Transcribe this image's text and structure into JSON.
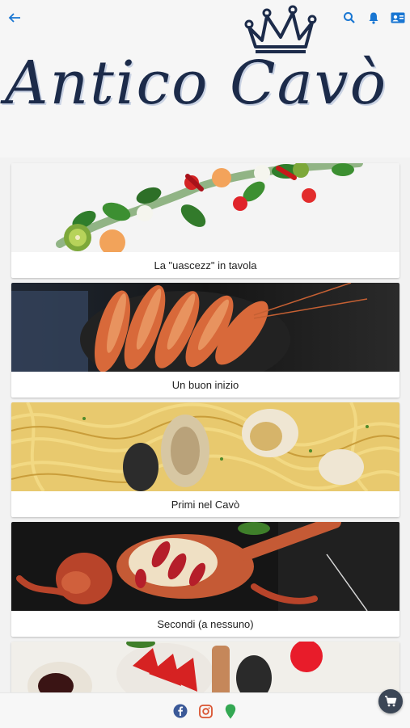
{
  "header": {
    "logo_text": "Antico Cavò",
    "back_icon": "arrow-left-icon",
    "search_icon": "search-icon",
    "notifications_icon": "bell-icon",
    "contacts_icon": "contact-card-icon",
    "accent_color": "#1976d2"
  },
  "menu": {
    "categories": [
      {
        "label": "La \"uascezz\" in tavola",
        "image": "salad-vegetables"
      },
      {
        "label": "Un buon inizio",
        "image": "grilled-prawns"
      },
      {
        "label": "Primi nel Cavò",
        "image": "spaghetti-clams"
      },
      {
        "label": "Secondi (a nessuno)",
        "image": "lobster"
      },
      {
        "label": "",
        "image": "strawberry-dessert"
      }
    ]
  },
  "footer": {
    "facebook_icon": "facebook-icon",
    "instagram_icon": "instagram-icon",
    "location_icon": "map-pin-icon",
    "cart_icon": "cart-icon"
  }
}
